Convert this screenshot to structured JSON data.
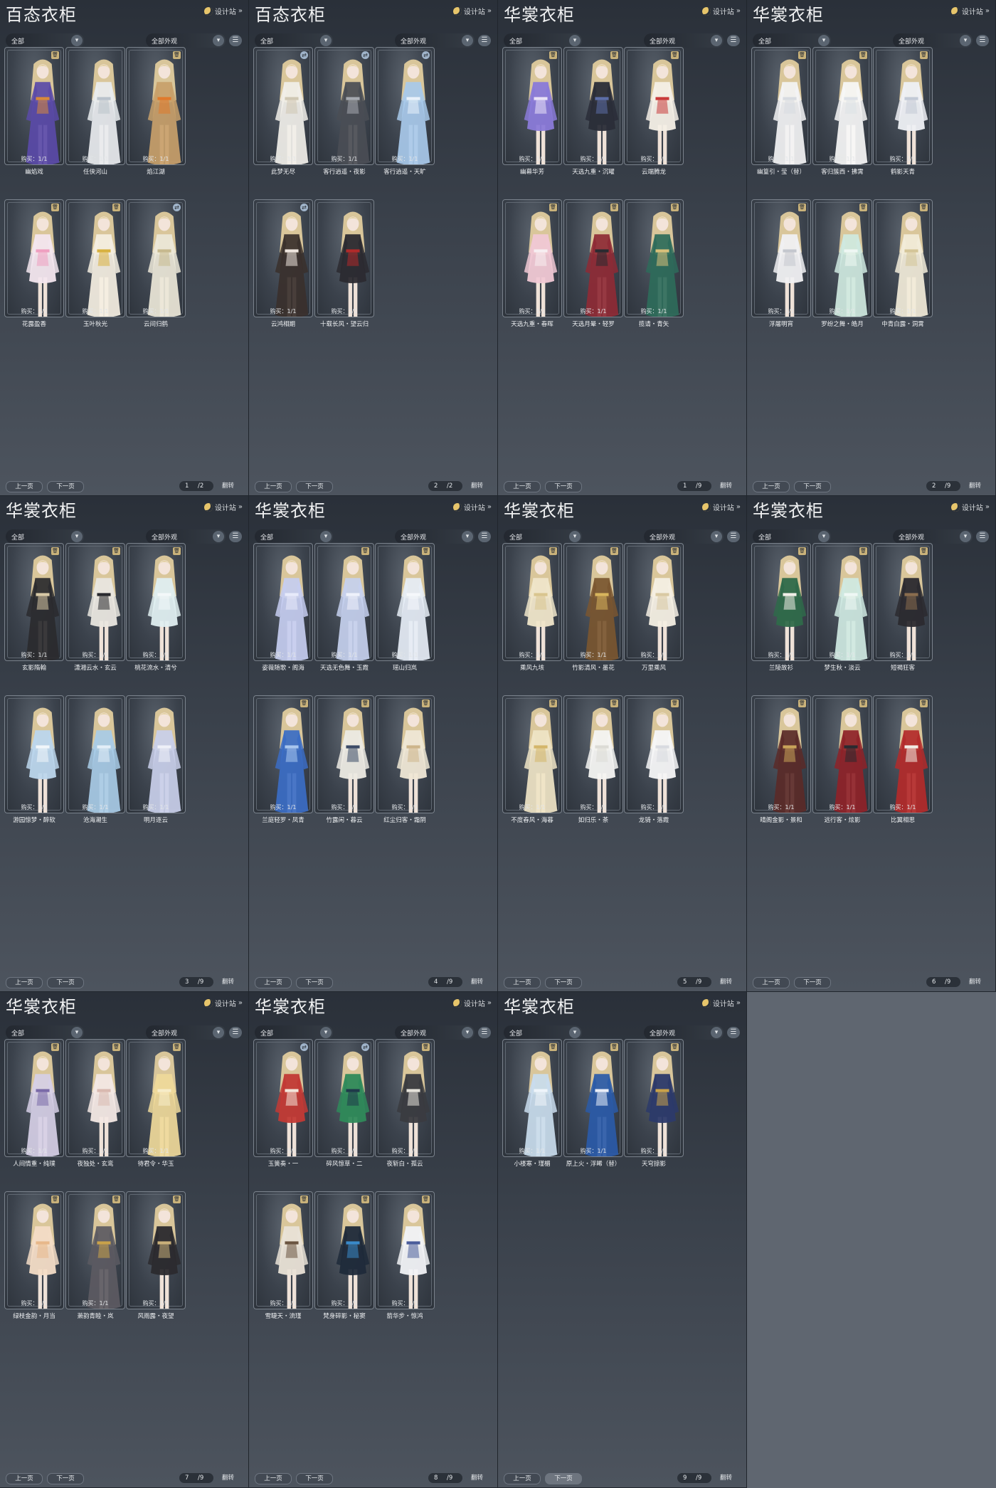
{
  "common": {
    "designer_label": "设计站",
    "filter_all": "全部",
    "filter_appearance": "全部外观",
    "prev_label": "上一页",
    "next_label": "下一页",
    "flip_label": "翻转"
  },
  "panels": [
    {
      "title": "百态衣柜",
      "page": "1",
      "total": "/2",
      "cards": [
        {
          "name": "幽焰戏",
          "buy": "购买：1/1",
          "tag": "trash",
          "dress": "#5a4aa8",
          "accent": "#d8893a",
          "long": true
        },
        {
          "name": "任侠河山",
          "buy": "购买：1/1",
          "tag": "",
          "dress": "#e9ecef",
          "accent": "#b9c2cb",
          "long": true
        },
        {
          "name": "焰江湖",
          "buy": "购买：1/1",
          "tag": "trash",
          "dress": "#c8a06a",
          "accent": "#e07a2c",
          "long": true
        },
        {
          "name": "花露盈香",
          "buy": "购买：1/1",
          "tag": "trash",
          "dress": "#f3e6ee",
          "accent": "#ef9fc0",
          "long": false
        },
        {
          "name": "玉叶秋光",
          "buy": "购买：1/1",
          "tag": "trash",
          "dress": "#f5efe2",
          "accent": "#d8b13f",
          "long": true
        },
        {
          "name": "云间归鹤",
          "buy": "购买：1/1",
          "tag": "swap",
          "dress": "#ece7d8",
          "accent": "#c7b98e",
          "long": true
        }
      ]
    },
    {
      "title": "百态衣柜",
      "page": "2",
      "total": "/2",
      "cards": [
        {
          "name": "此梦无尽",
          "buy": "购买：1/1",
          "tag": "swap",
          "dress": "#f1efe9",
          "accent": "#cfc7b3",
          "long": true
        },
        {
          "name": "客行逍遥・夜影",
          "buy": "购买：1/1",
          "tag": "swap",
          "dress": "#4a4d55",
          "accent": "#a5a9b0",
          "long": true
        },
        {
          "name": "客行逍遥・天旷",
          "buy": "购买：1/1",
          "tag": "swap",
          "dress": "#a8c9ea",
          "accent": "#e8f1fa",
          "long": true
        },
        {
          "name": "云鸿相期",
          "buy": "购买：1/1",
          "tag": "swap",
          "dress": "#3a302c",
          "accent": "#efe6df",
          "long": true
        },
        {
          "name": "十载长风・望云归",
          "buy": "购买：1/1",
          "tag": "",
          "dress": "#2b2a30",
          "accent": "#b12a2a",
          "long": false
        }
      ]
    },
    {
      "title": "华裳衣柜",
      "page": "1",
      "total": "/9",
      "cards": [
        {
          "name": "幽幕华芳",
          "buy": "购买：1/1",
          "tag": "trash",
          "dress": "#8a7ad8",
          "accent": "#e9e2f7",
          "long": false
        },
        {
          "name": "天选九重・沉曜",
          "buy": "购买：1/1",
          "tag": "trash",
          "dress": "#2a2d38",
          "accent": "#5c6ea8",
          "long": false
        },
        {
          "name": "云端腾龙",
          "buy": "购买：1/1",
          "tag": "trash",
          "dress": "#f4efe6",
          "accent": "#c93a3a",
          "long": false
        },
        {
          "name": "天选九重・春晖",
          "buy": "购买：1/1",
          "tag": "trash",
          "dress": "#f0c8d4",
          "accent": "#f7eef1",
          "long": false
        },
        {
          "name": "天选月晕・轻罗",
          "buy": "购买：1/1",
          "tag": "trash",
          "dress": "#8e2a35",
          "accent": "#2a2a30",
          "long": true
        },
        {
          "name": "揽请・青矢",
          "buy": "购买：1/1",
          "tag": "trash",
          "dress": "#2e6b5a",
          "accent": "#d8c07a",
          "long": true
        }
      ]
    },
    {
      "title": "华裳衣柜",
      "page": "2",
      "total": "/9",
      "cards": [
        {
          "name": "幽篁引・莹（替）",
          "buy": "购买：1/1",
          "tag": "trash",
          "dress": "#f3f3f4",
          "accent": "#d7dbe0",
          "long": true
        },
        {
          "name": "客归簇西・拂霄",
          "buy": "购买：1/1",
          "tag": "trash",
          "dress": "#f7f7f7",
          "accent": "#dde1e6",
          "long": true
        },
        {
          "name": "鹤影天青",
          "buy": "购买：1/1",
          "tag": "trash",
          "dress": "#eef0f4",
          "accent": "#c2c9d6",
          "long": false
        },
        {
          "name": "浮屠明宵",
          "buy": "购买：1/1",
          "tag": "trash",
          "dress": "#f0f0f2",
          "accent": "#c4c7ce",
          "long": false
        },
        {
          "name": "罗纷之舞・皓月",
          "buy": "购买：1/1",
          "tag": "trash",
          "dress": "#cfe9e0",
          "accent": "#eef7f3",
          "long": true
        },
        {
          "name": "中青白露・洞霄",
          "buy": "购买：1/1",
          "tag": "trash",
          "dress": "#f2ecd9",
          "accent": "#d4c598",
          "long": true
        }
      ]
    },
    {
      "title": "华裳衣柜",
      "page": "3",
      "total": "/9",
      "cards": [
        {
          "name": "玄影隋翰",
          "buy": "购买：1/1",
          "tag": "trash",
          "dress": "#2a2a2e",
          "accent": "#d8c9a6",
          "long": true
        },
        {
          "name": "潇湘云水・玄云",
          "buy": "购买：1/1",
          "tag": "trash",
          "dress": "#e9e6df",
          "accent": "#2a2a2e",
          "long": false
        },
        {
          "name": "桃花流水・清兮",
          "buy": "购买：1/1",
          "tag": "trash",
          "dress": "#dfeef0",
          "accent": "#f3f8f9",
          "long": false
        },
        {
          "name": "游园惊梦・醉软",
          "buy": "购买：1/1",
          "tag": "",
          "dress": "#bcd6ec",
          "accent": "#f1f6fa",
          "long": false
        },
        {
          "name": "沧海潮生",
          "buy": "购买：1/1",
          "tag": "",
          "dress": "#a8cbe6",
          "accent": "#e3eef7",
          "long": true
        },
        {
          "name": "明月逐云",
          "buy": "购买：1/1",
          "tag": "",
          "dress": "#c9cfea",
          "accent": "#eef0f8",
          "long": true
        }
      ]
    },
    {
      "title": "华裳衣柜",
      "page": "4",
      "total": "/9",
      "cards": [
        {
          "name": "姿薇随歌・阁海",
          "buy": "购买：1/1",
          "tag": "",
          "dress": "#c6cdf0",
          "accent": "#e7eafa",
          "long": true
        },
        {
          "name": "天选无色舞・玉霞",
          "buy": "购买：1/1",
          "tag": "trash",
          "dress": "#c5d0ee",
          "accent": "#eef1fb",
          "long": true
        },
        {
          "name": "瑶山归岚",
          "buy": "购买：1/1",
          "tag": "trash",
          "dress": "#e6edf6",
          "accent": "#f5f8fb",
          "long": true
        },
        {
          "name": "兰庭轻罗・凤青",
          "buy": "购买：1/1",
          "tag": "trash",
          "dress": "#3b6cc4",
          "accent": "#a9c6ee",
          "long": true
        },
        {
          "name": "竹露闲・暮云",
          "buy": "购买：1/1",
          "tag": "trash",
          "dress": "#eceae3",
          "accent": "#3b4a66",
          "long": false
        },
        {
          "name": "红尘归客・霜阴",
          "buy": "购买：1/1",
          "tag": "trash",
          "dress": "#efe7d5",
          "accent": "#cdb58a",
          "long": false
        }
      ]
    },
    {
      "title": "华裳衣柜",
      "page": "5",
      "total": "/9",
      "cards": [
        {
          "name": "乘风九垓",
          "buy": "购买：1/1",
          "tag": "trash",
          "dress": "#efe5c9",
          "accent": "#d9c58f",
          "long": false
        },
        {
          "name": "竹影清风・墨花",
          "buy": "购买：1/1",
          "tag": "trash",
          "dress": "#7a5630",
          "accent": "#d8b55d",
          "long": true
        },
        {
          "name": "万里乘风",
          "buy": "购买：1/1",
          "tag": "trash",
          "dress": "#f4efe3",
          "accent": "#d9c9a3",
          "long": false
        },
        {
          "name": "不度春风・海暮",
          "buy": "购买：1/1",
          "tag": "trash",
          "dress": "#efe4c6",
          "accent": "#d4b66a",
          "long": true
        },
        {
          "name": "如归乐・茶",
          "buy": "购买：1/1",
          "tag": "trash",
          "dress": "#f4f4f2",
          "accent": "#dddcd6",
          "long": false
        },
        {
          "name": "龙骑・落霞",
          "buy": "购买：1/1",
          "tag": "trash",
          "dress": "#f6f6f7",
          "accent": "#d9dbe0",
          "long": false
        }
      ]
    },
    {
      "title": "华裳衣柜",
      "page": "6",
      "total": "/9",
      "cards": [
        {
          "name": "兰陵故衫",
          "buy": "购买：1/1",
          "tag": "trash",
          "dress": "#2f6a4a",
          "accent": "#f1efe8",
          "long": false
        },
        {
          "name": "梦生秋・淡云",
          "buy": "购买：1/1",
          "tag": "trash",
          "dress": "#cfe9e2",
          "accent": "#eef7f4",
          "long": true
        },
        {
          "name": "短褐狂客",
          "buy": "购买：1/1",
          "tag": "trash",
          "dress": "#2b2a2f",
          "accent": "#8a6d4e",
          "long": false
        },
        {
          "name": "晴阁金影・景和",
          "buy": "购买：1/1",
          "tag": "trash",
          "dress": "#5a2a28",
          "accent": "#c9a45a",
          "long": true
        },
        {
          "name": "远行客・炫影",
          "buy": "购买：1/1",
          "tag": "trash",
          "dress": "#8e2228",
          "accent": "#2a2a30",
          "long": true
        },
        {
          "name": "比翼相思",
          "buy": "购买：1/1",
          "tag": "trash",
          "dress": "#b32a2a",
          "accent": "#f2ece4",
          "long": true
        }
      ]
    },
    {
      "title": "华裳衣柜",
      "page": "7",
      "total": "/9",
      "cards": [
        {
          "name": "人间情重・纯璞",
          "buy": "购买：1/1",
          "tag": "trash",
          "dress": "#d6cfe6",
          "accent": "#7a6aa8",
          "long": true
        },
        {
          "name": "夜独处・玄鸾",
          "buy": "购买：1/1",
          "tag": "trash",
          "dress": "#f3e8e4",
          "accent": "#d9b9b0",
          "long": false
        },
        {
          "name": "待君令・华玉",
          "buy": "购买：1/1",
          "tag": "trash",
          "dress": "#efd99a",
          "accent": "#f7ecc8",
          "long": true
        },
        {
          "name": "绿枝金韵・月当",
          "buy": "购买：1/1",
          "tag": "trash",
          "dress": "#f3dcc6",
          "accent": "#e7b88a",
          "long": false
        },
        {
          "name": "萧韵青睦・岚",
          "buy": "购买：1/1",
          "tag": "trash",
          "dress": "#5c5a62",
          "accent": "#c9a24a",
          "long": true
        },
        {
          "name": "风雨露・夜望",
          "buy": "购买：1/1",
          "tag": "trash",
          "dress": "#2b2a2e",
          "accent": "#c9b07a",
          "long": false
        }
      ]
    },
    {
      "title": "华裳衣柜",
      "page": "8",
      "total": "/9",
      "cards": [
        {
          "name": "玉簧奏・一",
          "buy": "购买：5/5",
          "tag": "swap",
          "dress": "#c23a35",
          "accent": "#f3e5d9",
          "long": false
        },
        {
          "name": "碎风惊草・二",
          "buy": "购买：5/5",
          "tag": "swap",
          "dress": "#2f8a5a",
          "accent": "#1f3a4a",
          "long": false
        },
        {
          "name": "夜斩白・孤云",
          "buy": "购买：1/1",
          "tag": "trash",
          "dress": "#3a3b40",
          "accent": "#e5e2da",
          "long": false
        },
        {
          "name": "雪睫天・流瑾",
          "buy": "购买：1/1",
          "tag": "trash",
          "dress": "#e9e2d6",
          "accent": "#6a5440",
          "long": false
        },
        {
          "name": "梵身碎影・秘窦",
          "buy": "购买：1/1",
          "tag": "trash",
          "dress": "#1f2a3a",
          "accent": "#3a8ac9",
          "long": false
        },
        {
          "name": "箭华步・惊鸿",
          "buy": "购买：1/1",
          "tag": "trash",
          "dress": "#f1f2f5",
          "accent": "#4a5c9a",
          "long": false
        }
      ]
    },
    {
      "title": "华裳衣柜",
      "page": "9",
      "total": "/9",
      "cards": [
        {
          "name": "小楼寒・瑾楣",
          "buy": "购买：1/1",
          "tag": "trash",
          "dress": "#c9dced",
          "accent": "#eef4fa",
          "long": true
        },
        {
          "name": "原上火・浮晞（替）",
          "buy": "购买：1/1",
          "tag": "trash",
          "dress": "#2a5aa8",
          "accent": "#e9eef7",
          "long": true
        },
        {
          "name": "天穹掠影",
          "buy": "购买：1/1",
          "tag": "trash",
          "dress": "#2c3a6a",
          "accent": "#c9a24a",
          "long": false
        }
      ]
    }
  ]
}
